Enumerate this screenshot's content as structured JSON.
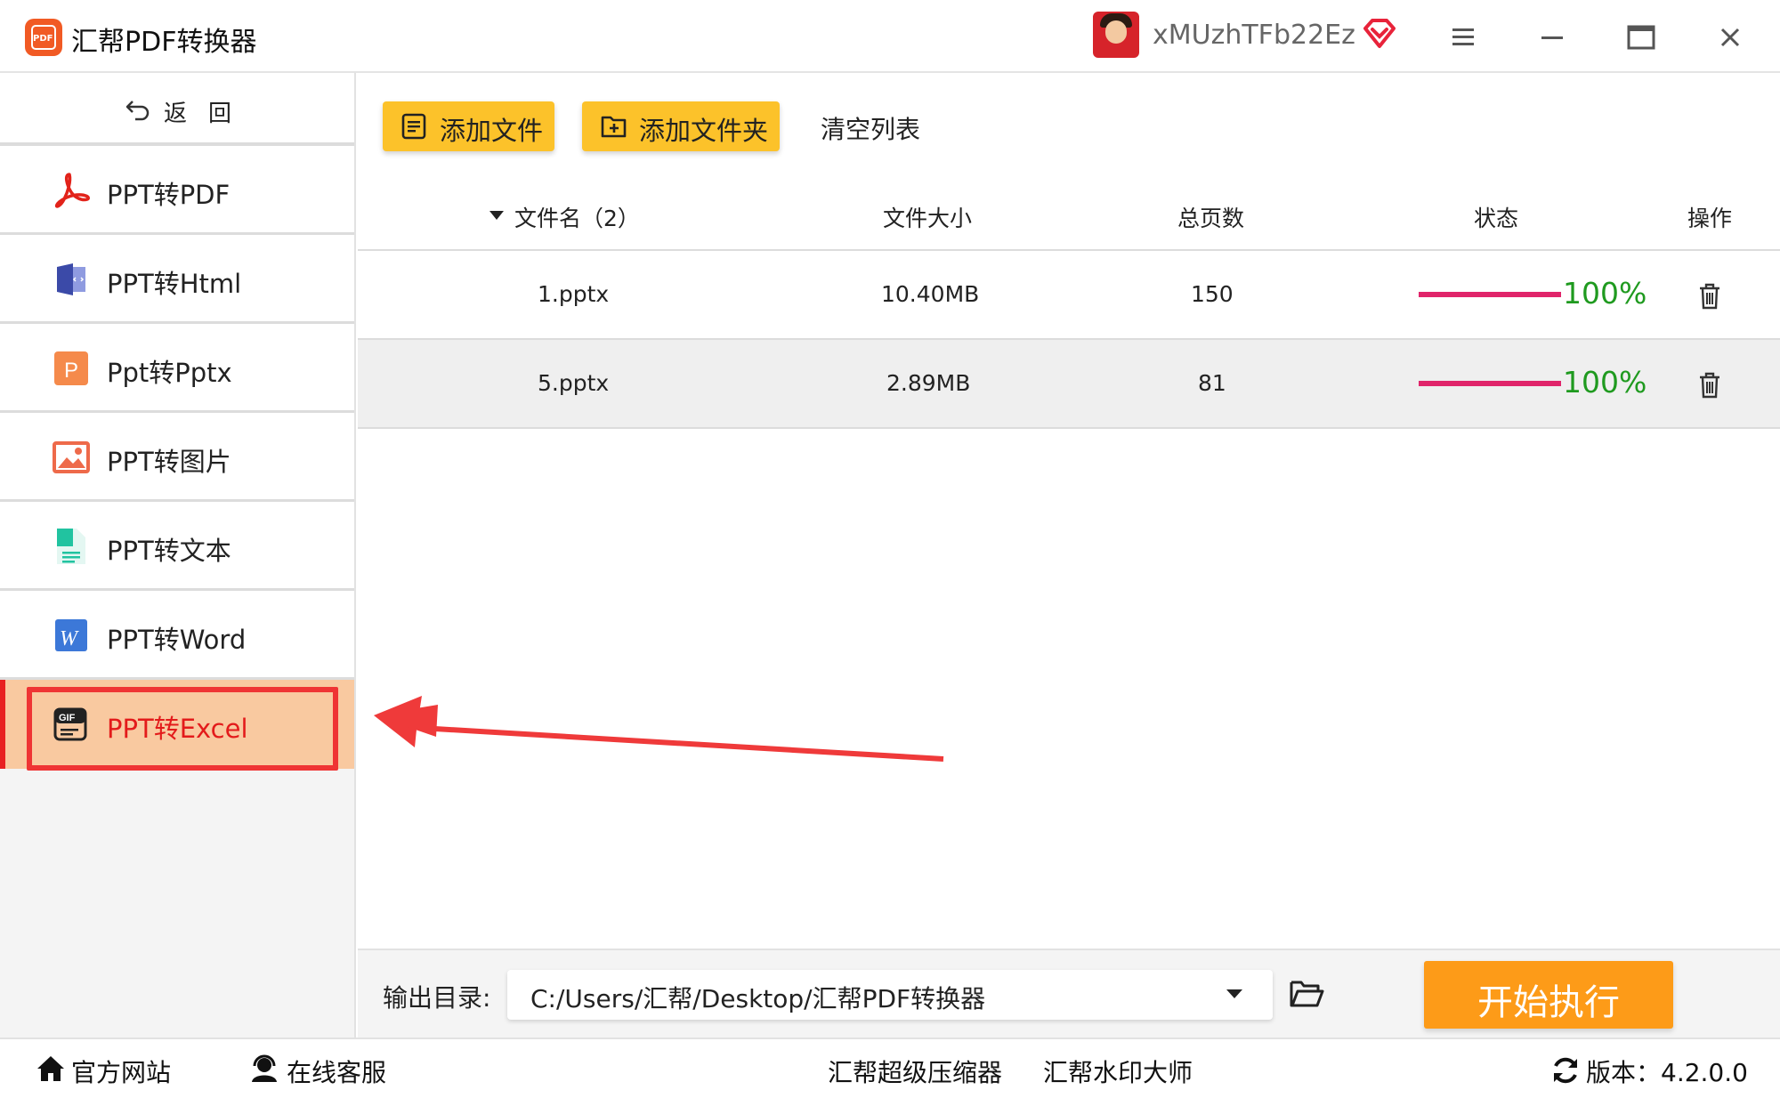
{
  "app": {
    "title": "汇帮PDF转换器",
    "logo_text": "PDF",
    "username": "xMUzhTFb22Ez"
  },
  "sidebar": {
    "back_label": "返回",
    "items": [
      {
        "label": "PPT转PDF",
        "icon": "pdf-icon"
      },
      {
        "label": "PPT转Html",
        "icon": "html-icon"
      },
      {
        "label": "Ppt转Pptx",
        "icon": "pptx-icon"
      },
      {
        "label": "PPT转图片",
        "icon": "image-icon"
      },
      {
        "label": "PPT转文本",
        "icon": "text-file-icon"
      },
      {
        "label": "PPT转Word",
        "icon": "word-icon"
      },
      {
        "label": "PPT转Excel",
        "icon": "gif-icon",
        "active": true
      }
    ]
  },
  "toolbar": {
    "add_file": "添加文件",
    "add_folder": "添加文件夹",
    "clear_list": "清空列表"
  },
  "table": {
    "columns": [
      "文件名（2）",
      "文件大小",
      "总页数",
      "状态",
      "操作"
    ],
    "rows": [
      {
        "name": "1.pptx",
        "size": "10.40MB",
        "pages": "150",
        "progress": 100,
        "progress_text": "100%"
      },
      {
        "name": "5.pptx",
        "size": "2.89MB",
        "pages": "81",
        "progress": 100,
        "progress_text": "100%"
      }
    ]
  },
  "output": {
    "label": "输出目录:",
    "path": "C:/Users/汇帮/Desktop/汇帮PDF转换器",
    "start": "开始执行"
  },
  "statusbar": {
    "official_site": "官方网站",
    "online_service": "在线客服",
    "compressor": "汇帮超级压缩器",
    "watermark": "汇帮水印大师",
    "version": "版本：4.2.0.0"
  },
  "colors": {
    "accent_yellow": "#fcc22a",
    "start_orange": "#fd9b18",
    "active_bg": "#f9c9a0",
    "active_text": "#e31b1b",
    "progress_bar": "#e0246a",
    "progress_text": "#1f9a1f"
  }
}
